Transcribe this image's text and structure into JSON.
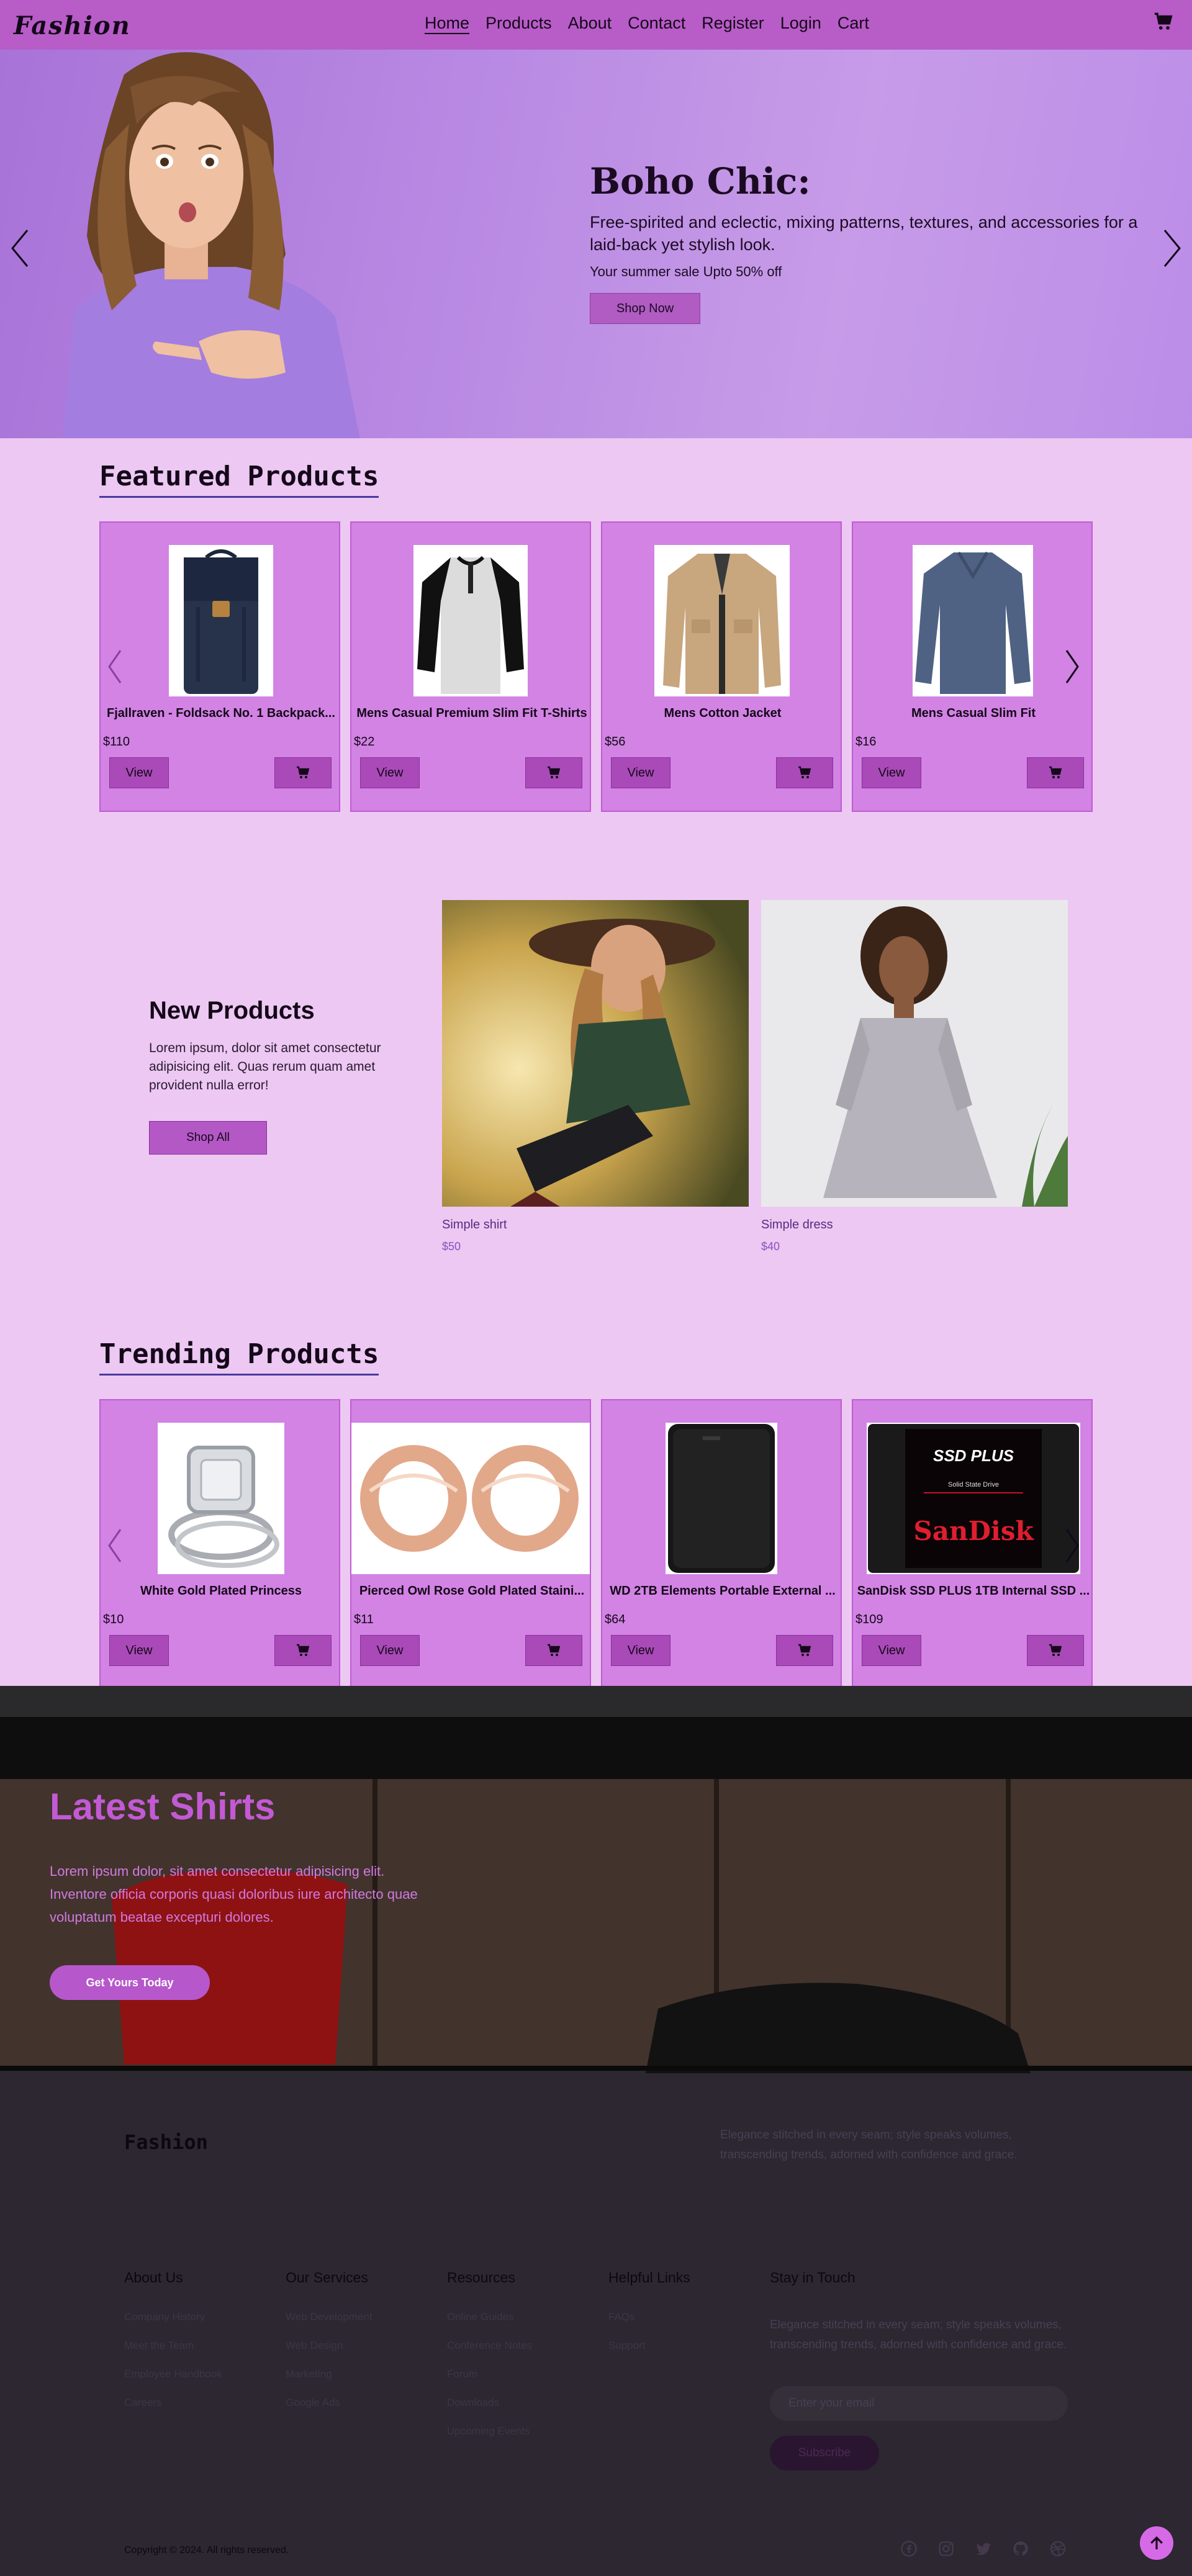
{
  "nav": {
    "logo": "Fashion",
    "links": [
      "Home",
      "Products",
      "About",
      "Contact",
      "Register",
      "Login",
      "Cart"
    ]
  },
  "hero": {
    "title": "Boho Chic:",
    "description": "Free-spirited and eclectic, mixing patterns, textures, and accessories for a laid-back yet stylish look.",
    "sale_text": "Your summer sale Upto 50% off",
    "button": "Shop Now"
  },
  "featured": {
    "title": "Featured Products",
    "products": [
      {
        "name": "Fjallraven - Foldsack No. 1 Backpack...",
        "price": "$110",
        "view": "View"
      },
      {
        "name": "Mens Casual Premium Slim Fit T-Shirts",
        "price": "$22",
        "view": "View"
      },
      {
        "name": "Mens Cotton Jacket",
        "price": "$56",
        "view": "View"
      },
      {
        "name": "Mens Casual Slim Fit",
        "price": "$16",
        "view": "View"
      }
    ]
  },
  "new_products": {
    "title": "New Products",
    "description": "Lorem ipsum, dolor sit amet consectetur adipisicing elit. Quas rerum quam amet provident nulla error!",
    "button": "Shop All",
    "items": [
      {
        "name": "Simple shirt",
        "price": "$50"
      },
      {
        "name": "Simple dress",
        "price": "$40"
      }
    ]
  },
  "trending": {
    "title": "Trending Products",
    "products": [
      {
        "name": "White Gold Plated Princess",
        "price": "$10",
        "view": "View"
      },
      {
        "name": "Pierced Owl Rose Gold Plated Staini...",
        "price": "$11",
        "view": "View"
      },
      {
        "name": "WD 2TB Elements Portable External ...",
        "price": "$64",
        "view": "View"
      },
      {
        "name": "SanDisk SSD PLUS 1TB Internal SSD ...",
        "price": "$109",
        "view": "View"
      }
    ],
    "ssd_label": {
      "brand": "SanDisk",
      "model": "SSD PLUS",
      "sub": "Solid State Drive"
    }
  },
  "latest_shirts": {
    "title": "Latest Shirts",
    "description": "Lorem ipsum dolor, sit amet consectetur adipisicing elit. Inventore officia corporis quasi doloribus iure architecto quae voluptatum beatae excepturi dolores.",
    "button": "Get Yours Today"
  },
  "footer": {
    "brand": "Fashion",
    "tagline": "Elegance stitched in every seam; style speaks volumes, transcending trends, adorned with confidence and grace.",
    "columns": [
      {
        "title": "About Us",
        "links": [
          "Company History",
          "Meet the Team",
          "Employee Handbook",
          "Careers"
        ]
      },
      {
        "title": "Our Services",
        "links": [
          "Web Development",
          "Web Design",
          "Marketing",
          "Google Ads"
        ]
      },
      {
        "title": "Resources",
        "links": [
          "Online Guides",
          "Conference Notes",
          "Forum",
          "Downloads",
          "Upcoming Events"
        ]
      },
      {
        "title": "Helpful Links",
        "links": [
          "FAQs",
          "Support"
        ]
      }
    ],
    "stay": {
      "title": "Stay in Touch",
      "text": "Elegance stitched in every seam; style speaks volumes, transcending trends, adorned with confidence and grace.",
      "email_placeholder": "Enter your email",
      "button": "Subscribe"
    },
    "copyright": "Copyright © 2024. All rights reserved.",
    "social": [
      "facebook-icon",
      "instagram-icon",
      "twitter-icon",
      "github-icon",
      "dribbble-icon"
    ]
  },
  "colors": {
    "nav_bg": "#b85cc8",
    "page_bg": "#ecc8f2",
    "card_bg": "#d283e4",
    "accent": "#b658cb",
    "footer_bg": "#2c2731"
  }
}
